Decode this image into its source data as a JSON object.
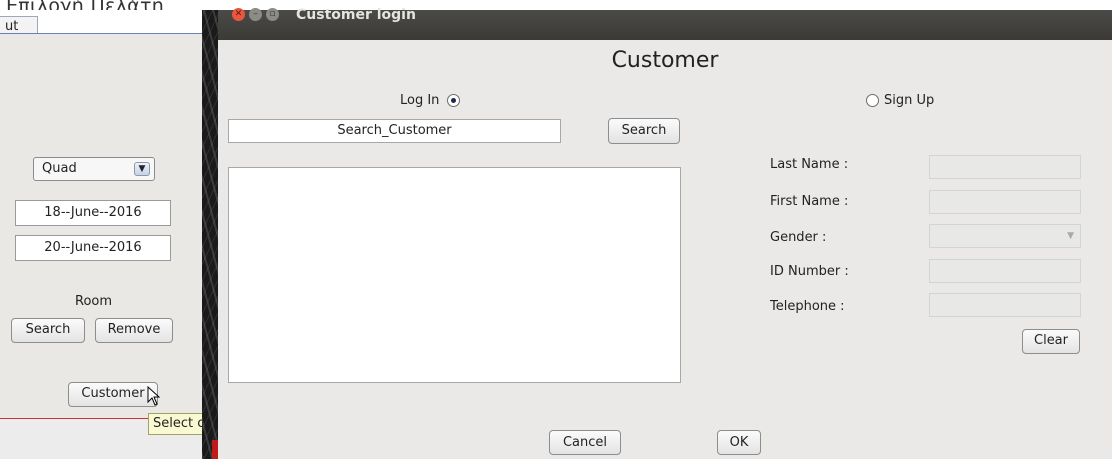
{
  "top_header": "Επιλογή Πελάτη",
  "background_window": {
    "tab_label": "ut",
    "room_type_value": "Quad",
    "check_in_date": "18--June--2016",
    "check_out_date": "20--June--2016",
    "room_label": "Room",
    "search_button": "Search",
    "remove_button": "Remove",
    "customer_button": "Customer",
    "tooltip": "Select customer"
  },
  "dialog": {
    "window_title": "Customer login",
    "heading": "Customer",
    "login_radio": "Log In",
    "signup_radio": "Sign Up",
    "selected_mode": "login",
    "search_value": "Search_Customer",
    "search_button": "Search",
    "fields": {
      "last_name": "Last Name :",
      "first_name": "First Name :",
      "gender": "Gender :",
      "id_number": "ID Number :",
      "telephone": "Telephone :"
    },
    "clear_button": "Clear",
    "cancel_button": "Cancel",
    "ok_button": "OK"
  },
  "colors": {
    "titlebar": "#3b3a37",
    "close_button": "#e9573f",
    "tooltip_bg": "#fafad2",
    "dialog_bg": "#eae9e7"
  }
}
